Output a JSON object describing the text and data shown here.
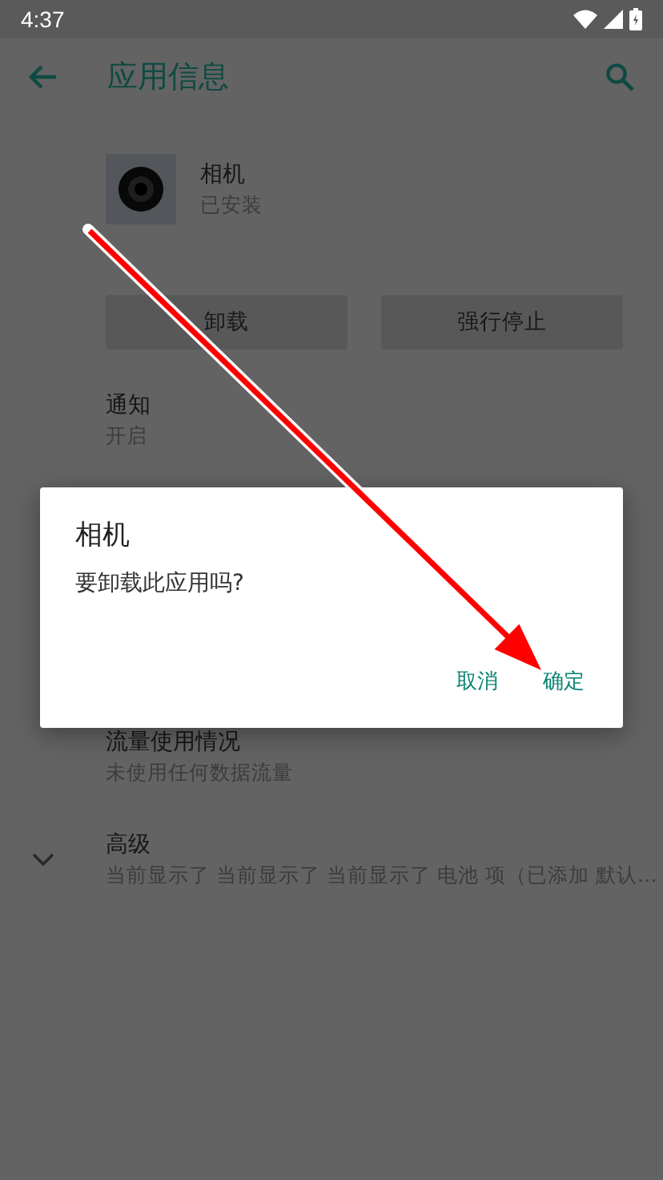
{
  "status_bar": {
    "time": "4:37"
  },
  "toolbar": {
    "title": "应用信息"
  },
  "app": {
    "name": "相机",
    "status": "已安装"
  },
  "actions": [
    "卸载",
    "强行停止"
  ],
  "settings": [
    {
      "title": "通知",
      "summary": "开启",
      "kind": "plain"
    },
    {
      "title": "流量使用情况",
      "summary": "未使用任何数据流量",
      "kind": "plain"
    },
    {
      "title": "高级",
      "summary": "当前显示了 当前显示了 当前显示了 电池 项（已添加 默认…",
      "kind": "expandable"
    }
  ],
  "dialog": {
    "title": "相机",
    "message": "要卸载此应用吗?",
    "buttons": [
      "取消",
      "确定"
    ]
  }
}
